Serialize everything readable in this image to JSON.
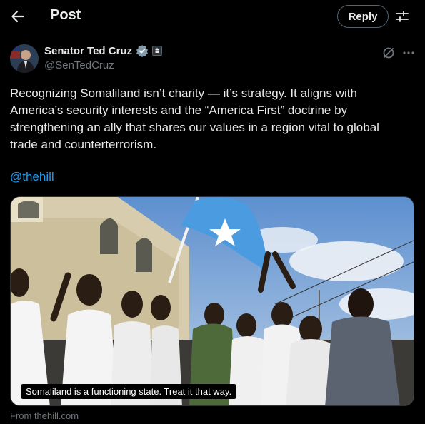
{
  "header": {
    "title": "Post",
    "reply_label": "Reply",
    "back_icon": "arrow-left-icon",
    "settings_icon": "sliders-icon"
  },
  "author": {
    "name": "Senator Ted Cruz",
    "handle": "@SenTedCruz",
    "verified_color": "#829aab",
    "badge_icon": "government-badge-icon"
  },
  "post": {
    "text": "Recognizing Somaliland isn’t charity — it’s strategy. It aligns with America’s security interests and the “America First” doctrine by strengthening an ally that shares our values in a region vital to global trade and counterterrorism.",
    "mention": "@thehill"
  },
  "media": {
    "caption": "Somaliland is a functioning state. Treat it that way.",
    "source": "From thehill.com"
  },
  "colors": {
    "background": "#000000",
    "accent": "#1d9bf0",
    "secondary_text": "#71767b",
    "flag_blue": "#4a9be0"
  }
}
